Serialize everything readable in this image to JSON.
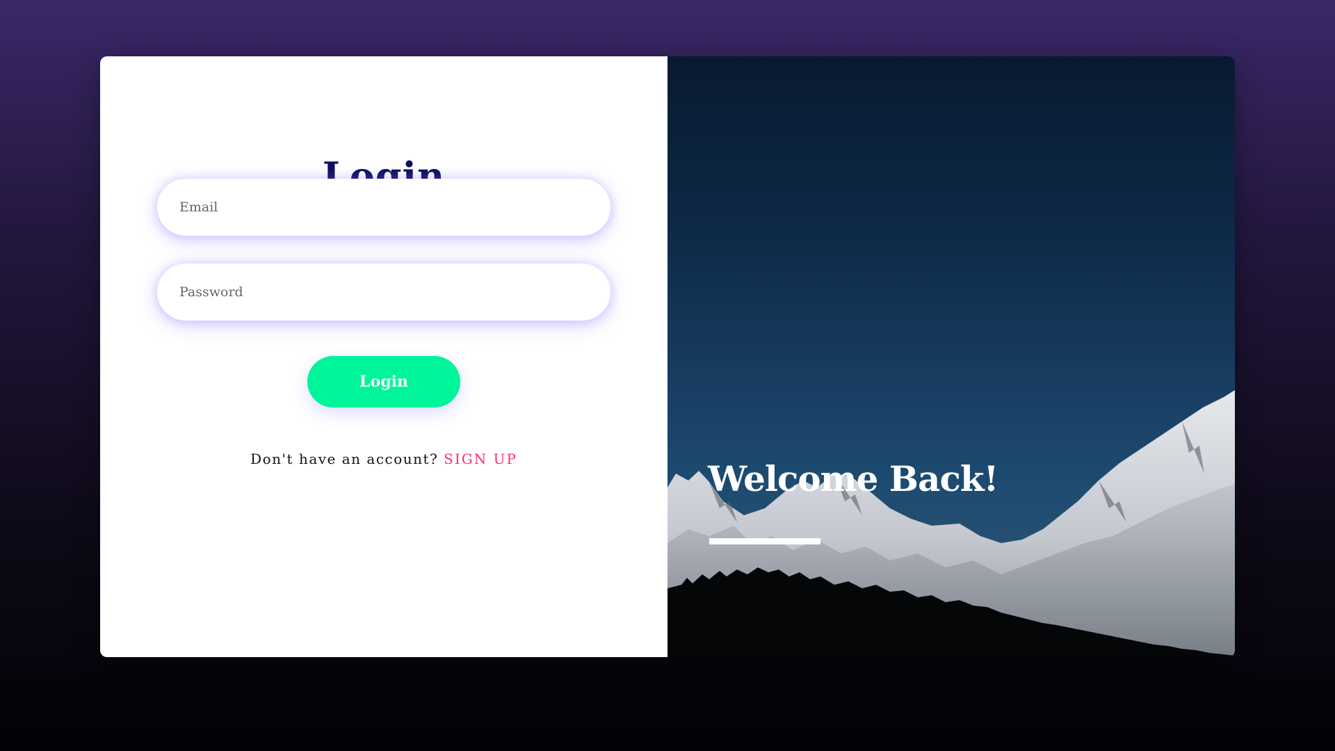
{
  "login": {
    "title": "Login",
    "email_placeholder": "Email",
    "password_placeholder": "Password",
    "button_label": "Login",
    "signup_prompt": "Don't have an account?",
    "signup_link": "SIGN UP"
  },
  "hero": {
    "title": "Welcome Back!"
  },
  "colors": {
    "title": "#10105e",
    "button": "#00f59a",
    "signup_link": "#ff2d6f",
    "field_glow": "#8c82ff",
    "background_top": "#3a2868",
    "background_bottom": "#020205"
  }
}
